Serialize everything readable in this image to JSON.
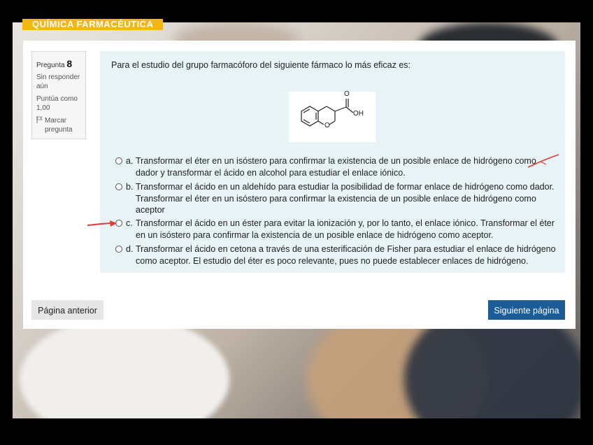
{
  "course_banner": "QUÍMICA FARMACÉUTICA",
  "question_info": {
    "label": "Pregunta",
    "number": "8",
    "status_line1": "Sin responder",
    "status_line2": "aún",
    "score_line1": "Puntúa como",
    "score_line2": "1,00",
    "flag_line1": "Marcar",
    "flag_line2": "pregunta"
  },
  "question": {
    "text": "Para el estudio del grupo farmacóforo del siguiente fármaco lo más eficaz es:",
    "structure_labels": {
      "oxygen_carbonyl": "O",
      "hydroxyl": "OH",
      "ring_oxygen": "O"
    },
    "options": [
      {
        "letter": "a.",
        "text": "Transformar el éter en un isóstero para confirmar la existencia de un posible enlace de hidrógeno como dador y transformar el ácido en alcohol para estudiar el enlace iónico."
      },
      {
        "letter": "b.",
        "text": "Transformar el ácido en un aldehído para estudiar la posibilidad de formar enlace de hidrógeno como dador. Transformar el éter en un isóstero para confirmar la existencia de un posible enlace de hidrógeno como aceptor"
      },
      {
        "letter": "c.",
        "text": "Transformar el ácido en un éster para evitar la ionización y, por lo tanto, el enlace iónico. Transformar el éter en un isóstero para confirmar la existencia de un posible enlace de hidrógeno como aceptor."
      },
      {
        "letter": "d.",
        "text": "Transformar el ácido en cetona a través de una esterificación de Fisher para estudiar el enlace de hidrógeno como aceptor. El estudio del éter es poco relevante, pues no puede establecer enlaces de hidrógeno."
      }
    ]
  },
  "nav": {
    "prev_label": "Página anterior",
    "next_label": "Siguiente página"
  },
  "colors": {
    "banner": "#f2b711",
    "next_button": "#1c5c97",
    "question_bg": "#e7f3f5",
    "annotation_red": "#e53935"
  },
  "icons": {
    "flag": "flag-icon",
    "annotation": "red-arrow-annotation"
  }
}
